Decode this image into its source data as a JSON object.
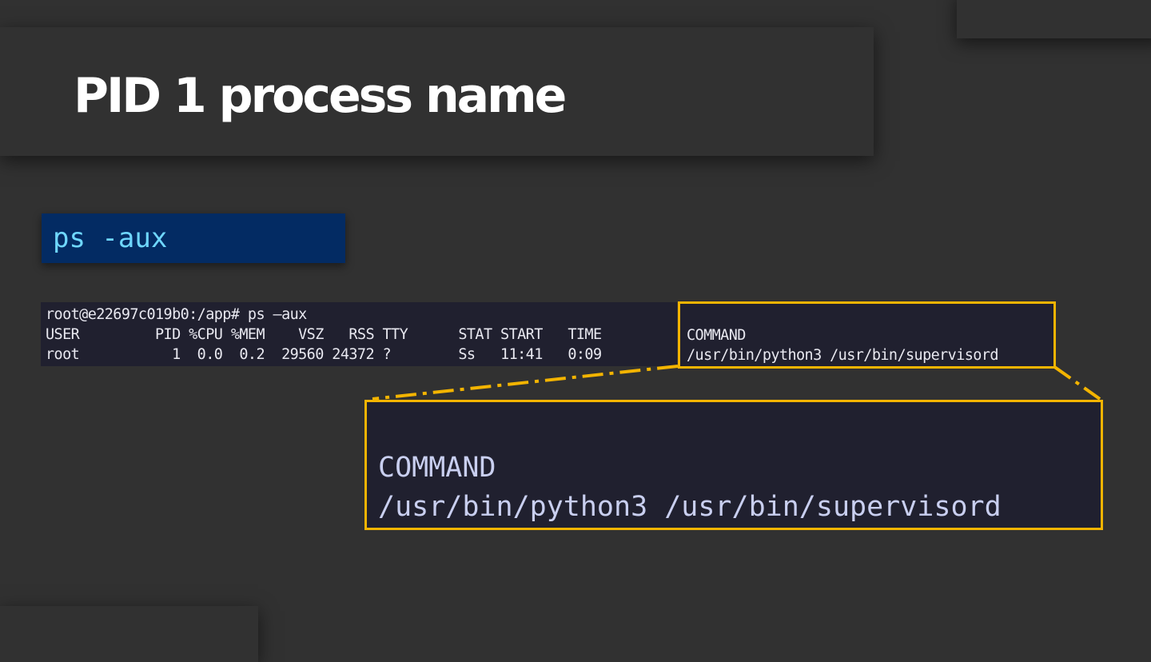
{
  "slide": {
    "title": "PID 1 process name",
    "command": "ps -aux"
  },
  "terminal": {
    "prompt_line": "root@e22697c019b0:/app# ps –aux",
    "header_left": "USER         PID %CPU %MEM    VSZ   RSS TTY      STAT START   TIME",
    "row_left": "root           1  0.0  0.2  29560 24372 ?        Ss   11:41   0:09",
    "header_command": "COMMAND",
    "row_command": "/usr/bin/python3 /usr/bin/supervisord"
  },
  "zoom": {
    "header": "COMMAND",
    "value": "/usr/bin/python3 /usr/bin/supervisord"
  },
  "colors": {
    "background": "#313131",
    "highlight": "#f3b400",
    "command_bg": "#032b63",
    "command_text": "#6fd7ff",
    "terminal_bg": "#20202f"
  }
}
